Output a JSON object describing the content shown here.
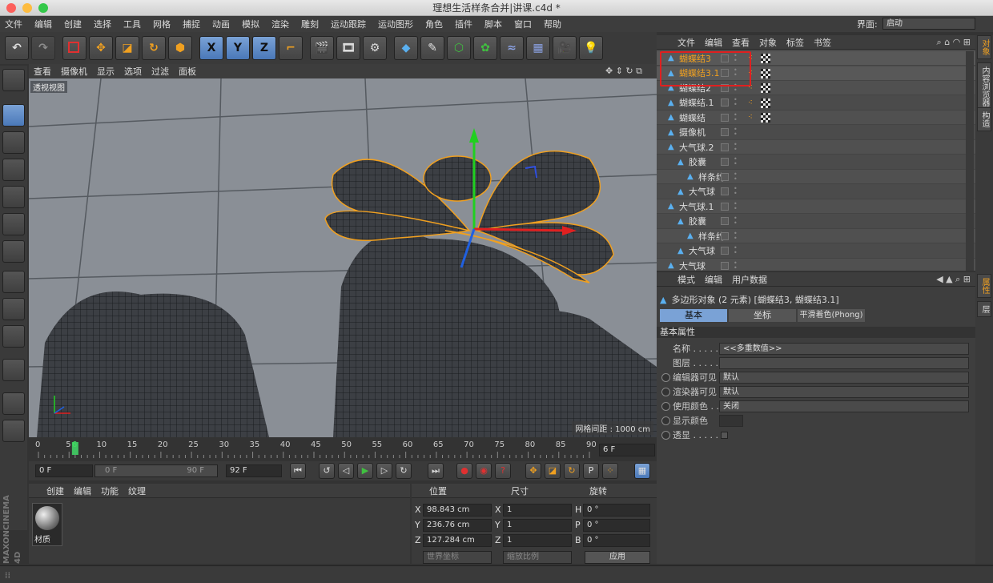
{
  "window": {
    "title": "理想生活样条合并|讲课.c4d *"
  },
  "menu": [
    "文件",
    "编辑",
    "创建",
    "选择",
    "工具",
    "网格",
    "捕捉",
    "动画",
    "模拟",
    "渲染",
    "雕刻",
    "运动跟踪",
    "运动图形",
    "角色",
    "插件",
    "脚本",
    "窗口",
    "帮助"
  ],
  "layout": {
    "label": "界面:",
    "value": "启动"
  },
  "toolbar": {
    "x": "X",
    "y": "Y",
    "z": "Z"
  },
  "viewport": {
    "menu": [
      "查看",
      "摄像机",
      "显示",
      "选项",
      "过滤",
      "面板"
    ],
    "label": "透视视图",
    "grid_note": "网格间距 : 1000 cm"
  },
  "timeline": {
    "ticks": [
      "0",
      "5",
      "6",
      "10",
      "15",
      "20",
      "25",
      "30",
      "35",
      "40",
      "45",
      "50",
      "55",
      "60",
      "65",
      "70",
      "75",
      "80",
      "85",
      "90"
    ],
    "frame_field": "6 F",
    "current_frame": 6
  },
  "transport": {
    "start": "0 F",
    "range_start": "0 F",
    "range_end": "90 F",
    "end": "92 F"
  },
  "materials": {
    "menu": [
      "创建",
      "编辑",
      "功能",
      "纹理"
    ],
    "item": "材质"
  },
  "coords": {
    "headers": [
      "位置",
      "尺寸",
      "旋转"
    ],
    "rows": [
      {
        "axis": "X",
        "pos": "98.843 cm",
        "saxis": "X",
        "size": "1",
        "raxis": "H",
        "rot": "0 °"
      },
      {
        "axis": "Y",
        "pos": "236.76 cm",
        "saxis": "Y",
        "size": "1",
        "raxis": "P",
        "rot": "0 °"
      },
      {
        "axis": "Z",
        "pos": "127.284 cm",
        "saxis": "Z",
        "size": "1",
        "raxis": "B",
        "rot": "0 °"
      }
    ],
    "mode1": "世界坐标",
    "mode2": "缩放比例",
    "apply": "应用"
  },
  "objects": {
    "menu": [
      "文件",
      "编辑",
      "查看",
      "对象",
      "标签",
      "书签"
    ],
    "items": [
      {
        "name": "蝴蝶结3",
        "indent": 0,
        "selected": true
      },
      {
        "name": "蝴蝶结3.1",
        "indent": 0,
        "selected": true
      },
      {
        "name": "蝴蝶结2",
        "indent": 0,
        "selected": false
      },
      {
        "name": "蝴蝶结.1",
        "indent": 0,
        "selected": false
      },
      {
        "name": "蝴蝶结",
        "indent": 0,
        "selected": false
      },
      {
        "name": "摄像机",
        "indent": 0,
        "selected": false
      },
      {
        "name": "大气球.2",
        "indent": 0,
        "selected": false
      },
      {
        "name": "胶囊",
        "indent": 1,
        "selected": false
      },
      {
        "name": "样条约",
        "indent": 2,
        "selected": false
      },
      {
        "name": "大气球",
        "indent": 1,
        "selected": false
      },
      {
        "name": "大气球.1",
        "indent": 0,
        "selected": false
      },
      {
        "name": "胶囊",
        "indent": 1,
        "selected": false
      },
      {
        "name": "样条约",
        "indent": 2,
        "selected": false
      },
      {
        "name": "大气球",
        "indent": 1,
        "selected": false
      },
      {
        "name": "大气球",
        "indent": 0,
        "selected": false
      }
    ]
  },
  "attributes": {
    "menu": [
      "模式",
      "编辑",
      "用户数据"
    ],
    "title": "多边形对象 (2 元素) [蝴蝶结3, 蝴蝶结3.1]",
    "tabs": [
      "基本",
      "坐标",
      "平滑着色(Phong)"
    ],
    "section": "基本属性",
    "rows": [
      {
        "label": "名称 . . . . .",
        "value": "<<多重数值>>"
      },
      {
        "label": "图层 . . . . .",
        "value": ""
      },
      {
        "label": "编辑器可见",
        "value": "默认"
      },
      {
        "label": "渲染器可见",
        "value": "默认"
      },
      {
        "label": "使用颜色 . .",
        "value": "关闭"
      },
      {
        "label": "显示颜色",
        "value": ""
      },
      {
        "label": "透显 . . . . .",
        "value": ""
      }
    ]
  },
  "sidetabs": [
    "对象",
    "内容浏览器",
    "构造",
    "属性",
    "层"
  ],
  "brand": [
    "MAXON",
    "CINEMA 4D"
  ],
  "colors": {
    "selected": "#f0a020",
    "accent": "#4a78b8",
    "highlight": "#e02020"
  }
}
